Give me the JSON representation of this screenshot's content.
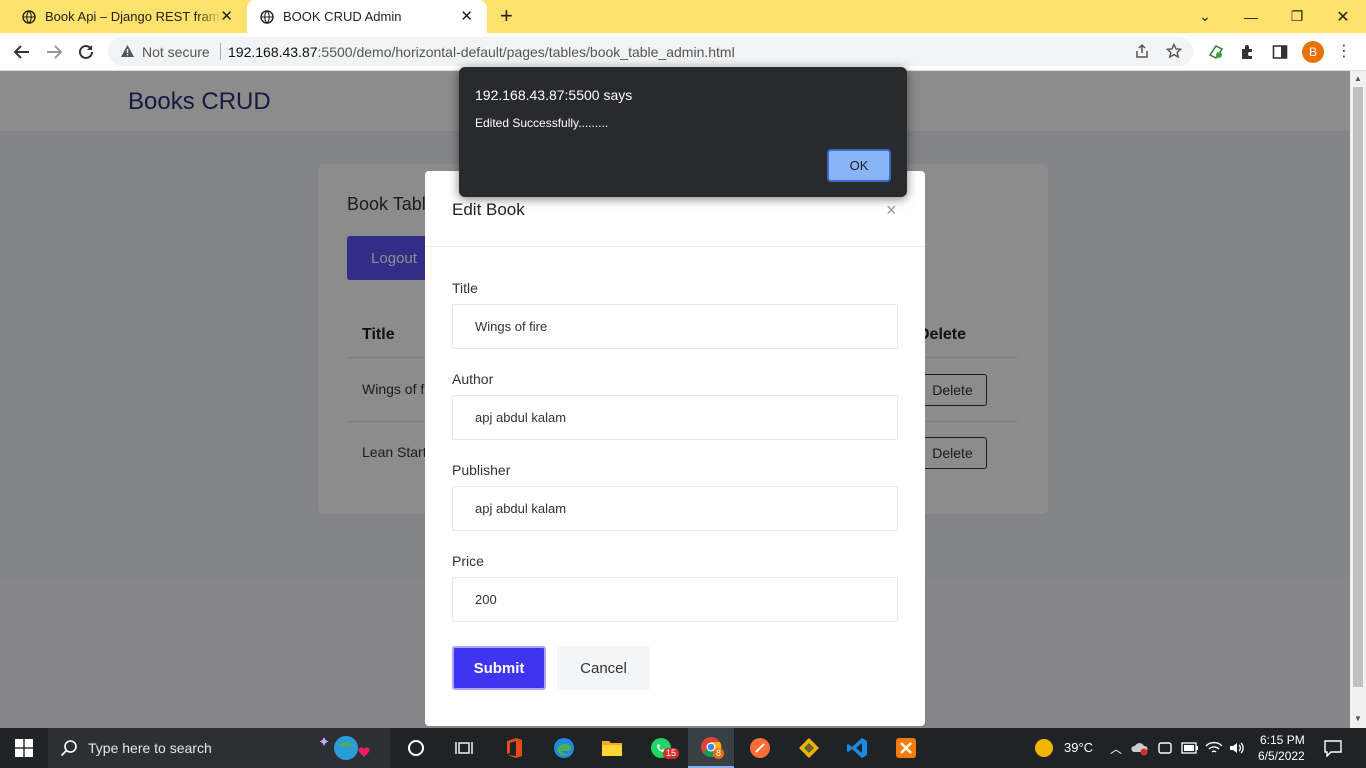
{
  "browser": {
    "tabs": [
      {
        "title": "Book Api – Django REST framework",
        "active": false
      },
      {
        "title": "BOOK CRUD Admin",
        "active": true
      }
    ],
    "new_tab": "+",
    "security_label": "Not secure",
    "url_host": "192.168.43.87",
    "url_rest": ":5500/demo/horizontal-default/pages/tables/book_table_admin.html",
    "profile_initial": "B"
  },
  "page": {
    "brand": "Books CRUD",
    "card_title": "Book Tabl",
    "logout_label": "Logout",
    "table": {
      "headers": {
        "title": "Title",
        "delete": "Delete"
      },
      "rows": [
        {
          "title": "Wings of f",
          "delete_label": "Delete"
        },
        {
          "title": "Lean Start",
          "delete_label": "Delete"
        }
      ]
    }
  },
  "modal": {
    "title": "Edit Book",
    "close": "×",
    "fields": {
      "title": {
        "label": "Title",
        "value": "Wings of fire"
      },
      "author": {
        "label": "Author",
        "value": "apj abdul kalam"
      },
      "publisher": {
        "label": "Publisher",
        "value": "apj abdul kalam"
      },
      "price": {
        "label": "Price",
        "value": "200"
      }
    },
    "submit_label": "Submit",
    "cancel_label": "Cancel"
  },
  "alert": {
    "origin": "192.168.43.87:5500 says",
    "message": "Edited Successfully.........",
    "ok_label": "OK"
  },
  "taskbar": {
    "search_placeholder": "Type here to search",
    "whatsapp_badge": "15",
    "chrome_badge": "8",
    "temperature": "39°C",
    "time": "6:15 PM",
    "date": "6/5/2022"
  },
  "colors": {
    "tabstrip": "#fde26b",
    "primary": "#5b52f5",
    "submit": "#3f35f0",
    "brand_text": "#2b2f7a",
    "alert_bg": "#292a2d",
    "alert_ok": "#8ab4f8"
  }
}
